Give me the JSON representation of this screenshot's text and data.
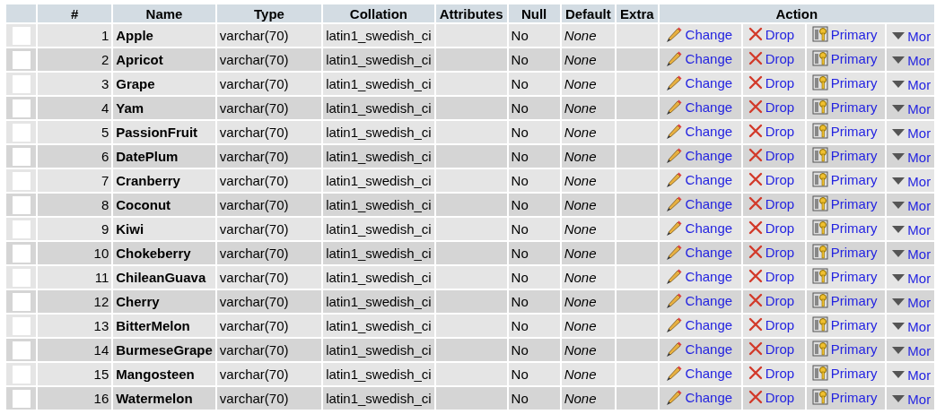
{
  "columns": [
    "#",
    "Name",
    "Type",
    "Collation",
    "Attributes",
    "Null",
    "Default",
    "Extra",
    "Action"
  ],
  "rows": [
    {
      "checked": false,
      "num": "1",
      "name": "Apple",
      "type": "varchar(70)",
      "collation": "latin1_swedish_ci",
      "null": "No",
      "default": "None",
      "change": "Change",
      "drop": "Drop",
      "primary": "Primary",
      "more": "Mor"
    },
    {
      "checked": false,
      "num": "2",
      "name": "Apricot",
      "type": "varchar(70)",
      "collation": "latin1_swedish_ci",
      "null": "No",
      "default": "None",
      "change": "Change",
      "drop": "Drop",
      "primary": "Primary",
      "more": "Mor"
    },
    {
      "checked": false,
      "num": "3",
      "name": "Grape",
      "type": "varchar(70)",
      "collation": "latin1_swedish_ci",
      "null": "No",
      "default": "None",
      "change": "Change",
      "drop": "Drop",
      "primary": "Primary",
      "more": "Mor"
    },
    {
      "checked": false,
      "num": "4",
      "name": "Yam",
      "type": "varchar(70)",
      "collation": "latin1_swedish_ci",
      "null": "No",
      "default": "None",
      "change": "Change",
      "drop": "Drop",
      "primary": "Primary",
      "more": "Mor"
    },
    {
      "checked": false,
      "num": "5",
      "name": "PassionFruit",
      "type": "varchar(70)",
      "collation": "latin1_swedish_ci",
      "null": "No",
      "default": "None",
      "change": "Change",
      "drop": "Drop",
      "primary": "Primary",
      "more": "Mor"
    },
    {
      "checked": false,
      "num": "6",
      "name": "DatePlum",
      "type": "varchar(70)",
      "collation": "latin1_swedish_ci",
      "null": "No",
      "default": "None",
      "change": "Change",
      "drop": "Drop",
      "primary": "Primary",
      "more": "Mor"
    },
    {
      "checked": false,
      "num": "7",
      "name": "Cranberry",
      "type": "varchar(70)",
      "collation": "latin1_swedish_ci",
      "null": "No",
      "default": "None",
      "change": "Change",
      "drop": "Drop",
      "primary": "Primary",
      "more": "Mor"
    },
    {
      "checked": false,
      "num": "8",
      "name": "Coconut",
      "type": "varchar(70)",
      "collation": "latin1_swedish_ci",
      "null": "No",
      "default": "None",
      "change": "Change",
      "drop": "Drop",
      "primary": "Primary",
      "more": "Mor"
    },
    {
      "checked": false,
      "num": "9",
      "name": "Kiwi",
      "type": "varchar(70)",
      "collation": "latin1_swedish_ci",
      "null": "No",
      "default": "None",
      "change": "Change",
      "drop": "Drop",
      "primary": "Primary",
      "more": "Mor"
    },
    {
      "checked": false,
      "num": "10",
      "name": "Chokeberry",
      "type": "varchar(70)",
      "collation": "latin1_swedish_ci",
      "null": "No",
      "default": "None",
      "change": "Change",
      "drop": "Drop",
      "primary": "Primary",
      "more": "Mor"
    },
    {
      "checked": false,
      "num": "11",
      "name": "ChileanGuava",
      "type": "varchar(70)",
      "collation": "latin1_swedish_ci",
      "null": "No",
      "default": "None",
      "change": "Change",
      "drop": "Drop",
      "primary": "Primary",
      "more": "Mor"
    },
    {
      "checked": false,
      "num": "12",
      "name": "Cherry",
      "type": "varchar(70)",
      "collation": "latin1_swedish_ci",
      "null": "No",
      "default": "None",
      "change": "Change",
      "drop": "Drop",
      "primary": "Primary",
      "more": "Mor"
    },
    {
      "checked": false,
      "num": "13",
      "name": "BitterMelon",
      "type": "varchar(70)",
      "collation": "latin1_swedish_ci",
      "null": "No",
      "default": "None",
      "change": "Change",
      "drop": "Drop",
      "primary": "Primary",
      "more": "Mor"
    },
    {
      "checked": false,
      "num": "14",
      "name": "BurmeseGrape",
      "type": "varchar(70)",
      "collation": "latin1_swedish_ci",
      "null": "No",
      "default": "None",
      "change": "Change",
      "drop": "Drop",
      "primary": "Primary",
      "more": "Mor"
    },
    {
      "checked": false,
      "num": "15",
      "name": "Mangosteen",
      "type": "varchar(70)",
      "collation": "latin1_swedish_ci",
      "null": "No",
      "default": "None",
      "change": "Change",
      "drop": "Drop",
      "primary": "Primary",
      "more": "Mor"
    },
    {
      "checked": false,
      "num": "16",
      "name": "Watermelon",
      "type": "varchar(70)",
      "collation": "latin1_swedish_ci",
      "null": "No",
      "default": "None",
      "change": "Change",
      "drop": "Drop",
      "primary": "Primary",
      "more": "Mor"
    }
  ]
}
